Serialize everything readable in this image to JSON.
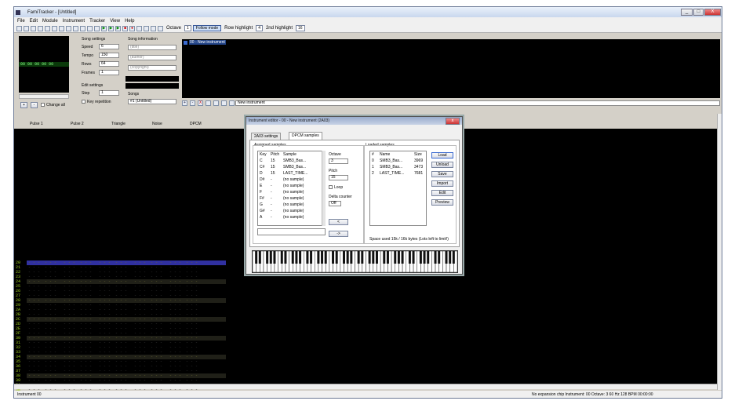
{
  "window": {
    "title": "FamiTracker - [Untitled]",
    "min": "_",
    "max": "□",
    "close": "X"
  },
  "menu": [
    "File",
    "Edit",
    "Module",
    "Instrument",
    "Tracker",
    "View",
    "Help"
  ],
  "toolbar": {
    "octave_label": "Octave",
    "octave_value": "1",
    "follow_mode": "Follow mode",
    "row_highlight_label": "Row highlight",
    "row_highlight_value": "4",
    "second_highlight_label": "2nd highlight",
    "second_highlight_value": "16"
  },
  "song_settings": {
    "heading": "Song settings",
    "speed_label": "Speed",
    "speed": "6",
    "tempo_label": "Tempo",
    "tempo": "150",
    "rows_label": "Rows",
    "rows": "64",
    "frames_label": "Frames",
    "frames": "1"
  },
  "song_info": {
    "heading": "Song information",
    "title_placeholder": "(title)",
    "author_placeholder": "(author)",
    "copyright_placeholder": "(copyright)"
  },
  "edit_settings": {
    "heading": "Edit settings",
    "step_label": "Step",
    "step": "1",
    "keyrepeat": "Key repetition",
    "changeall": "Change all",
    "song_label": "Songs",
    "song_value": "#1 (Untitled)"
  },
  "instrument_panel": {
    "item": "00 - New instrument",
    "name_label": "New instrument"
  },
  "channels": [
    "Pulse 1",
    "Pulse 2",
    "Triangle",
    "Noise",
    "DPCM"
  ],
  "frame_rows": [
    "00",
    "00",
    "00",
    "00",
    "00"
  ],
  "row_numbers": [
    "20",
    "21",
    "22",
    "23",
    "24",
    "25",
    "26",
    "27",
    "28",
    "29",
    "2A",
    "2B",
    "2C",
    "2D",
    "2E",
    "2F",
    "30",
    "31",
    "32",
    "33",
    "34",
    "35",
    "36",
    "37",
    "38",
    "39",
    "3A",
    "3B",
    "3C",
    "3D",
    "3E",
    "3F"
  ],
  "row_highlight_values": [
    "20",
    "24",
    "28",
    "2C",
    "30",
    "34",
    "38",
    "3C"
  ],
  "cursor_row": "20",
  "dialog": {
    "title": "Instrument editor - 00 - New instrument (2A03)",
    "tabs": [
      "2A03 settings",
      "DPCM samples"
    ],
    "assigned_heading": "Assigned samples",
    "assigned_cols": [
      "Key",
      "Pitch",
      "Sample"
    ],
    "assigned_rows": [
      {
        "key": "C",
        "pitch": "15",
        "sample": "SMB3_Bas..."
      },
      {
        "key": "C#",
        "pitch": "15",
        "sample": "SMB3_Bas..."
      },
      {
        "key": "D",
        "pitch": "15",
        "sample": "LAST_TIME..."
      },
      {
        "key": "D#",
        "pitch": "-",
        "sample": "(no sample)"
      },
      {
        "key": "E",
        "pitch": "-",
        "sample": "(no sample)"
      },
      {
        "key": "F",
        "pitch": "-",
        "sample": "(no sample)"
      },
      {
        "key": "F#",
        "pitch": "-",
        "sample": "(no sample)"
      },
      {
        "key": "G",
        "pitch": "-",
        "sample": "(no sample)"
      },
      {
        "key": "G#",
        "pitch": "-",
        "sample": "(no sample)"
      },
      {
        "key": "A",
        "pitch": "-",
        "sample": "(no sample)"
      }
    ],
    "octave_label": "Octave",
    "octave_value": "3",
    "pitch_label": "Pitch",
    "pitch_value": "15",
    "loop_label": "Loop",
    "delta_label": "Delta counter",
    "delta_value": "Off",
    "loaded_heading": "Loaded samples",
    "loaded_cols": [
      "#",
      "Name",
      "Size"
    ],
    "loaded_rows": [
      {
        "num": "0",
        "name": "SMB3_Bas...",
        "size": "3969"
      },
      {
        "num": "1",
        "name": "SMB3_Bas...",
        "size": "3473"
      },
      {
        "num": "2",
        "name": "LAST_TIME...",
        "size": "7681"
      }
    ],
    "buttons": [
      "Load",
      "Unload",
      "Save",
      "Import",
      "Edit",
      "Preview"
    ],
    "arrow_left": "<",
    "arrow_right": "->",
    "space_text": "Space used 15k / 16k bytes (Lots left to limit!)"
  },
  "statusbar": {
    "left": "Instrument 00",
    "right": "No expansion chip   Instrument: 00   Octave: 3   60 Hz   128 BPM   00:00:00"
  }
}
